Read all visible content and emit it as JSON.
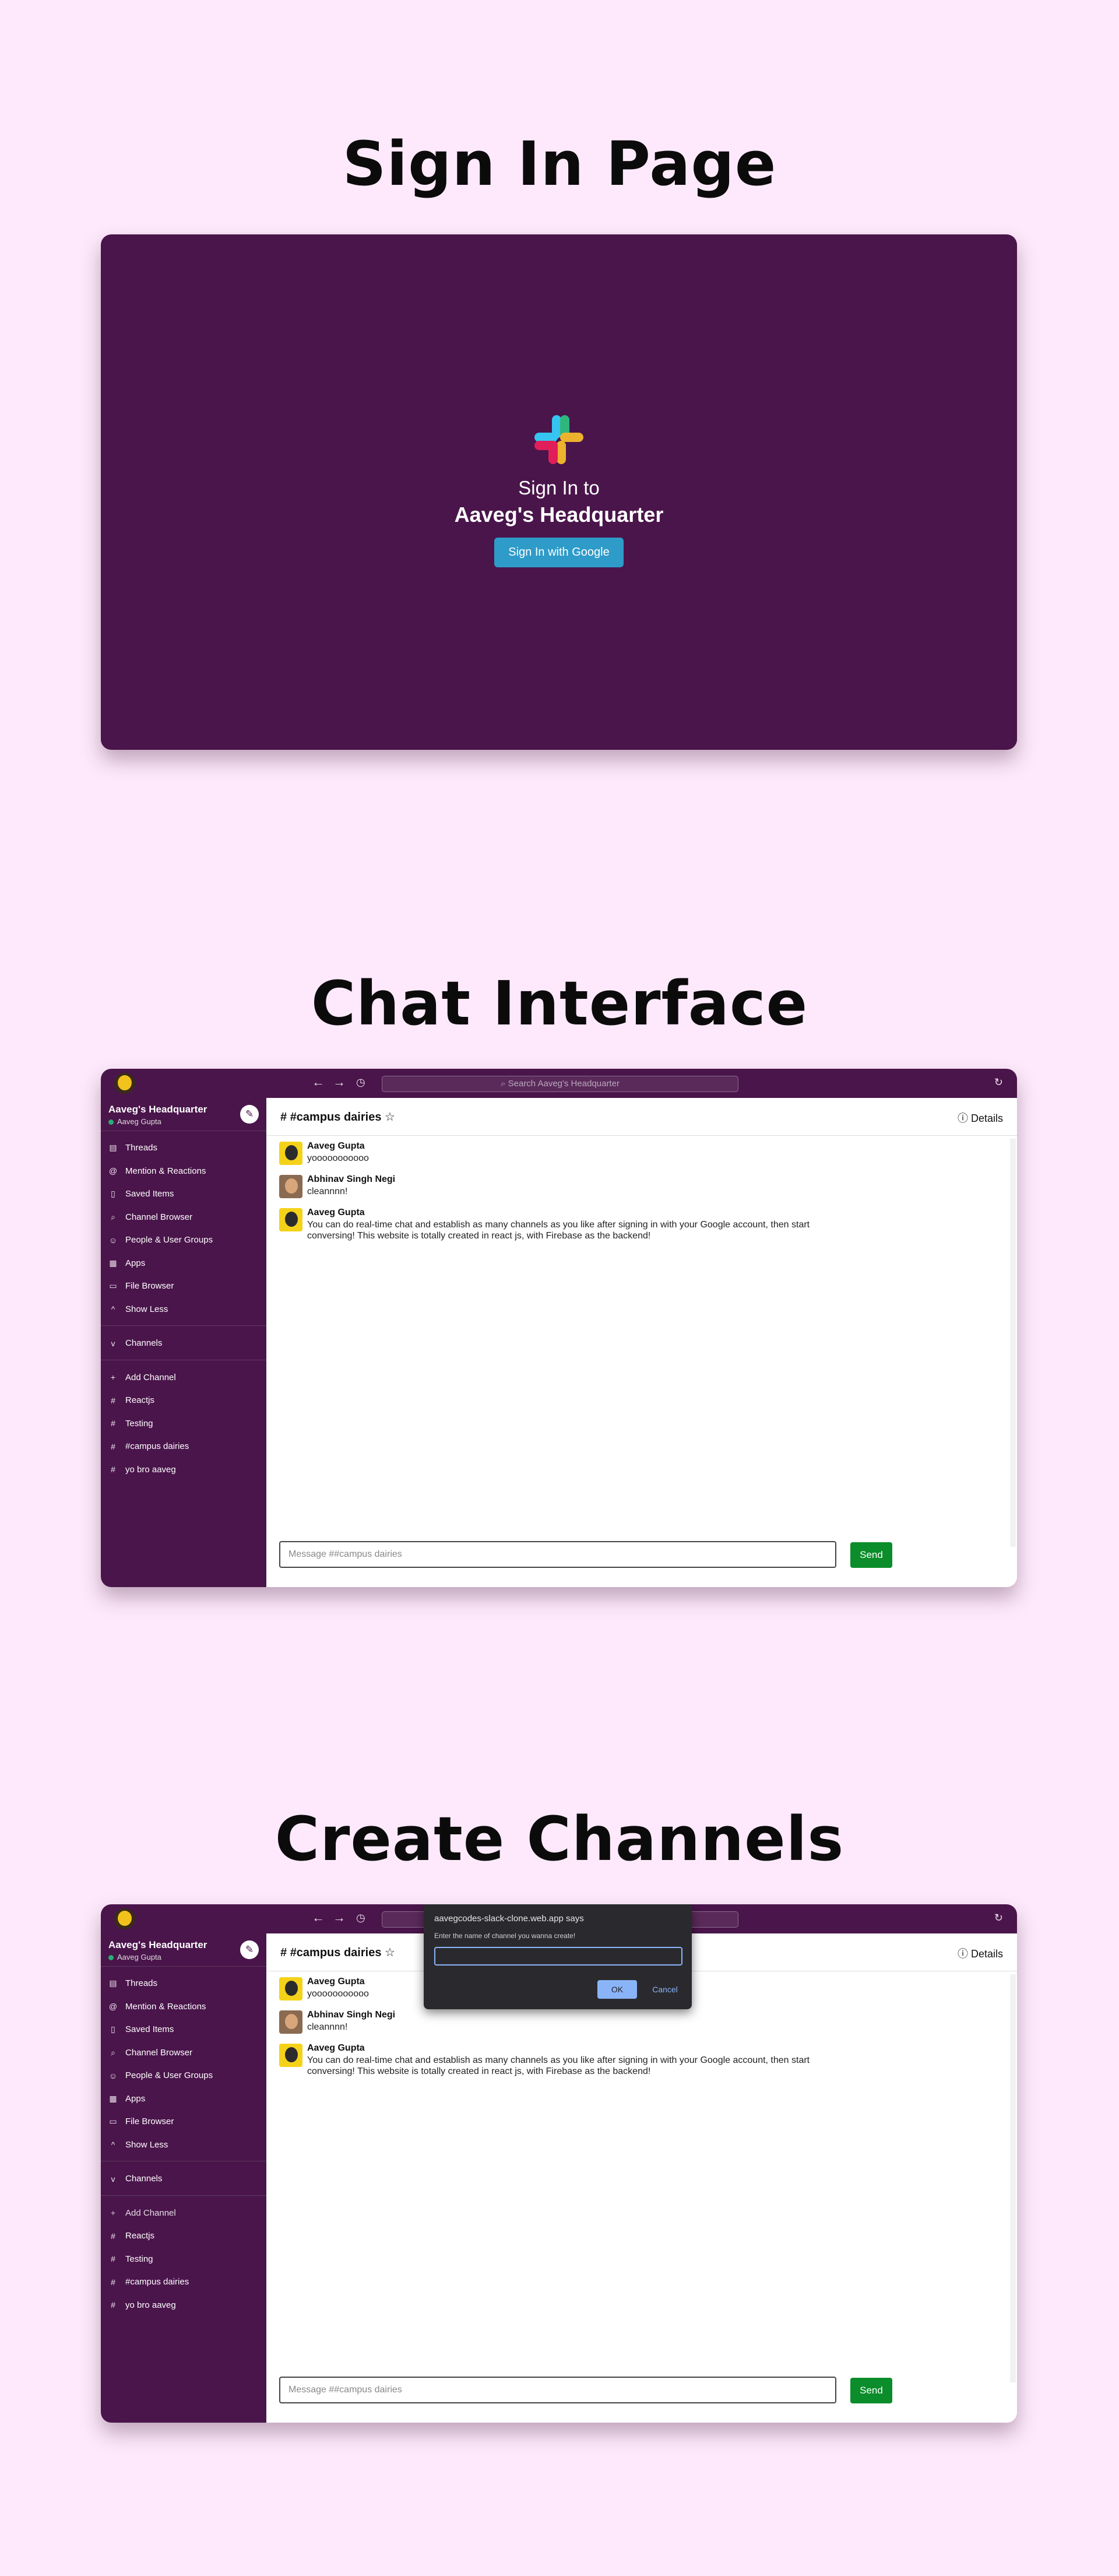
{
  "sections": {
    "signin_title": "Sign In Page",
    "chat_title": "Chat Interface",
    "create_title": "Create Channels"
  },
  "signin": {
    "line1": "Sign In to",
    "workspace": "Aaveg's Headquarter",
    "button": "Sign In with Google"
  },
  "topbar": {
    "search_placeholder": "Search Aaveg's Headquarter"
  },
  "sidebar": {
    "workspace": "Aaveg's Headquarter",
    "user": "Aaveg Gupta",
    "items": [
      "Threads",
      "Mention & Reactions",
      "Saved Items",
      "Channel Browser",
      "People & User Groups",
      "Apps",
      "File Browser",
      "Show Less"
    ],
    "channels_label": "Channels",
    "add_channel": "Add Channel",
    "channels": [
      "Reactjs",
      "Testing",
      "#campus dairies",
      "yo bro aaveg"
    ]
  },
  "channel": {
    "title": "#campus dairies",
    "details": "Details",
    "composer_placeholder": "Message ##campus dairies",
    "send": "Send"
  },
  "messages": [
    {
      "user": "Aaveg Gupta",
      "text": "yooooooooooo"
    },
    {
      "user": "Abhinav Singh Negi",
      "text": "cleannnn!"
    },
    {
      "user": "Aaveg Gupta",
      "text": "You can do real-time chat and establish as many channels as you like after signing in with your Google account, then start conversing! This website is totally created in react js, with Firebase as the backend!"
    }
  ],
  "dialog": {
    "origin": "aavegcodes-slack-clone.web.app says",
    "prompt": "Enter the name of channel you wanna create!",
    "ok": "OK",
    "cancel": "Cancel"
  },
  "colors": {
    "background": "#fde9fb",
    "aubergine": "#4a154b",
    "send_green": "#0a8d2a",
    "google_blue": "#2e9bc9"
  }
}
